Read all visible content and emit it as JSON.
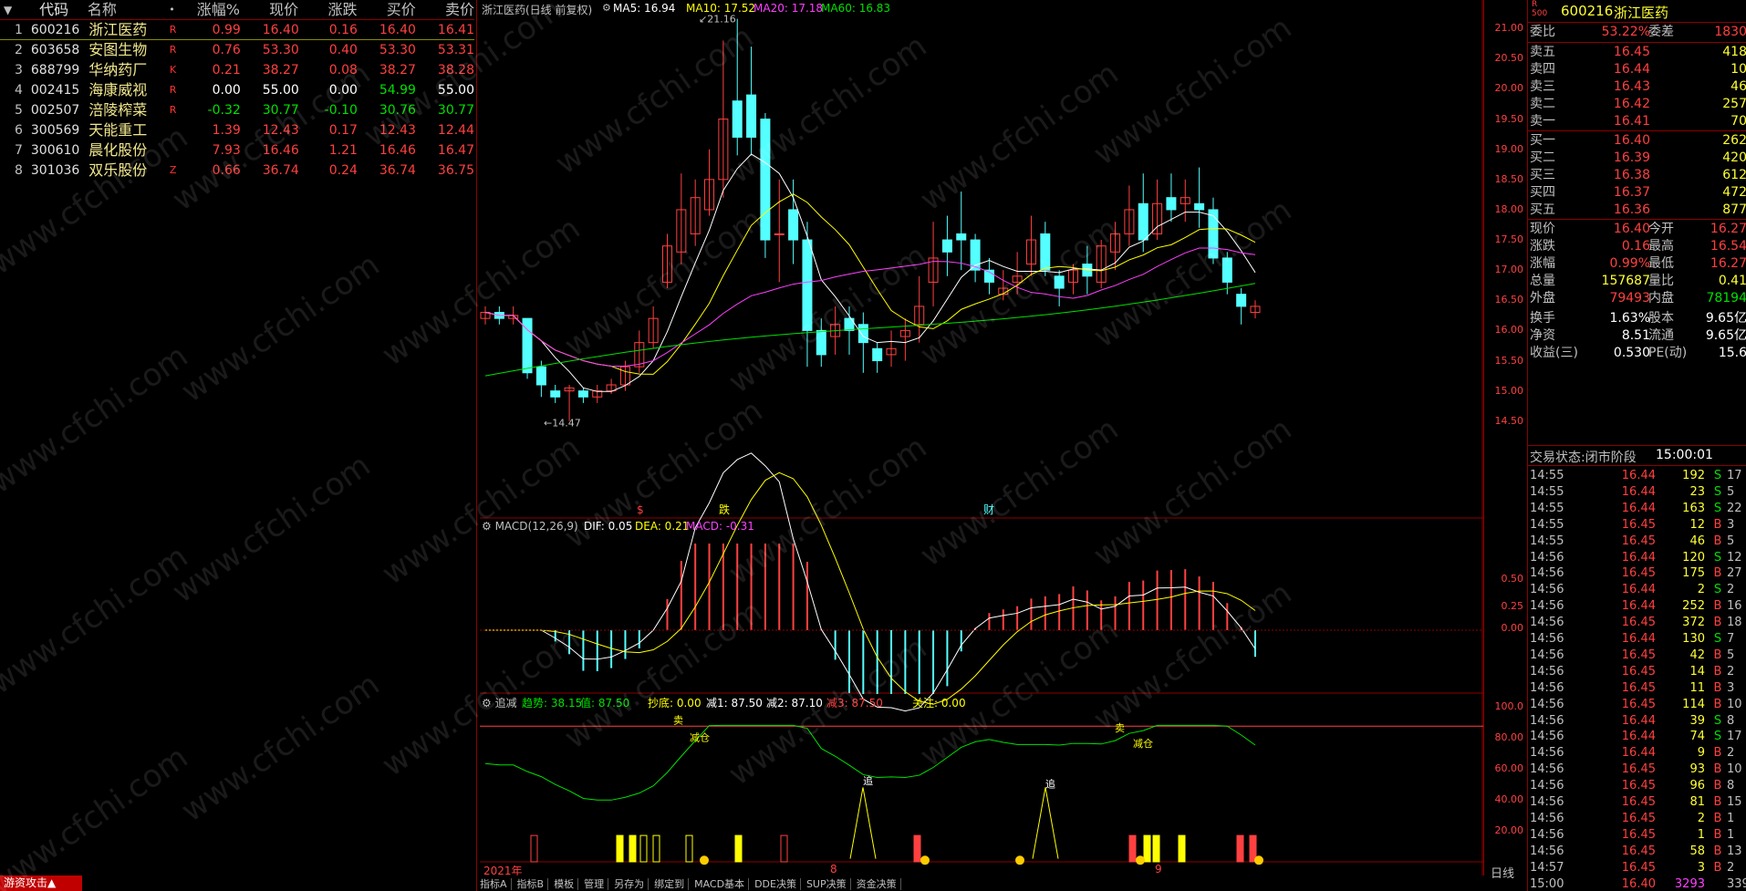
{
  "list": {
    "headers": [
      "代码",
      "名称",
      "•",
      "涨幅%",
      "现价",
      "涨跌",
      "买价",
      "卖价"
    ],
    "rows": [
      {
        "no": "1",
        "code": "600216",
        "name": "浙江医药",
        "flag": "R",
        "pct": "0.99",
        "price": "16.40",
        "chg": "0.16",
        "bid": "16.40",
        "ask": "16.41",
        "color": "red"
      },
      {
        "no": "2",
        "code": "603658",
        "name": "安图生物",
        "flag": "R",
        "pct": "0.76",
        "price": "53.30",
        "chg": "0.40",
        "bid": "53.30",
        "ask": "53.31",
        "color": "red"
      },
      {
        "no": "3",
        "code": "688799",
        "name": "华纳药厂",
        "flag": "K",
        "pct": "0.21",
        "price": "38.27",
        "chg": "0.08",
        "bid": "38.27",
        "ask": "38.28",
        "color": "red"
      },
      {
        "no": "4",
        "code": "002415",
        "name": "海康威视",
        "flag": "R",
        "pct": "0.00",
        "price": "55.00",
        "chg": "0.00",
        "bid": "54.99",
        "ask": "55.00",
        "color": "white"
      },
      {
        "no": "5",
        "code": "002507",
        "name": "涪陵榨菜",
        "flag": "R",
        "pct": "-0.32",
        "price": "30.77",
        "chg": "-0.10",
        "bid": "30.76",
        "ask": "30.77",
        "color": "green"
      },
      {
        "no": "6",
        "code": "300569",
        "name": "天能重工",
        "flag": "",
        "pct": "1.39",
        "price": "12.43",
        "chg": "0.17",
        "bid": "12.43",
        "ask": "12.44",
        "color": "red"
      },
      {
        "no": "7",
        "code": "300610",
        "name": "晨化股份",
        "flag": "",
        "pct": "7.93",
        "price": "16.46",
        "chg": "1.21",
        "bid": "16.46",
        "ask": "16.47",
        "color": "red"
      },
      {
        "no": "8",
        "code": "301036",
        "name": "双乐股份",
        "flag": "Z",
        "pct": "0.66",
        "price": "36.74",
        "chg": "0.24",
        "bid": "36.74",
        "ask": "36.75",
        "color": "red"
      }
    ],
    "bottom_tab": "游资攻击▲"
  },
  "chart": {
    "title": "浙江医药(日线 前复权)",
    "ma": {
      "ma5": "MA5: 16.94",
      "ma10": "MA10: 17.52",
      "ma20": "MA20: 17.18",
      "ma60": "MA60: 16.83"
    },
    "high_label": "21.16",
    "low_label": "14.47",
    "price_ticks": [
      "21.00",
      "20.50",
      "20.00",
      "19.50",
      "19.00",
      "18.50",
      "18.00",
      "17.50",
      "17.00",
      "16.50",
      "16.00",
      "15.50",
      "15.00",
      "14.50"
    ],
    "markers": {
      "s": "$",
      "die": "跌",
      "cai": "财"
    },
    "macd_title": "MACD(12,26,9)",
    "macd_dif": "DIF: 0.05",
    "macd_dea": "DEA: 0.21",
    "macd_macd": "MACD: -0.31",
    "macd_ticks": [
      "0.50",
      "0.25",
      "0.00"
    ],
    "ind_title": "追减",
    "ind_trend": "趋势: 38.15",
    "ind_val": "值: 87.50",
    "ind_bottom": "抄底: 0.00",
    "ind_j1": "减1: 87.50",
    "ind_j2": "减2: 87.10",
    "ind_j3": "减3: 87.50",
    "ind_focus": "关注: 0.00",
    "ind_ticks": [
      "100.0",
      "80.00",
      "60.00",
      "40.00",
      "20.00"
    ],
    "ind_labels": {
      "mai": "卖",
      "jiancang": "减仓",
      "zhui": "追"
    },
    "date_labels": [
      "2021年",
      "8",
      "9"
    ],
    "period": "日线"
  },
  "toolbar": [
    "指标A",
    "指标B",
    "模板",
    "管理",
    "另存为",
    "绑定到",
    "MACD基本",
    "DDE决策",
    "SUP决策",
    "资金决策"
  ],
  "right": {
    "header_code": "600216",
    "header_name": "浙江医药",
    "ratio": {
      "label": "委比",
      "value": "53.22%",
      "label2": "委差",
      "value2": "1830"
    },
    "asks": [
      {
        "label": "卖五",
        "price": "16.45",
        "vol": "418"
      },
      {
        "label": "卖四",
        "price": "16.44",
        "vol": "10"
      },
      {
        "label": "卖三",
        "price": "16.43",
        "vol": "46"
      },
      {
        "label": "卖二",
        "price": "16.42",
        "vol": "257"
      },
      {
        "label": "卖一",
        "price": "16.41",
        "vol": "70"
      }
    ],
    "bids": [
      {
        "label": "买一",
        "price": "16.40",
        "vol": "262"
      },
      {
        "label": "买二",
        "price": "16.39",
        "vol": "420"
      },
      {
        "label": "买三",
        "price": "16.38",
        "vol": "612"
      },
      {
        "label": "买四",
        "price": "16.37",
        "vol": "472"
      },
      {
        "label": "买五",
        "price": "16.36",
        "vol": "877"
      }
    ],
    "stats": [
      {
        "l": "现价",
        "v": "16.40",
        "c": "red",
        "l2": "今开",
        "v2": "16.27",
        "c2": "red"
      },
      {
        "l": "涨跌",
        "v": "0.16",
        "c": "red",
        "l2": "最高",
        "v2": "16.54",
        "c2": "red"
      },
      {
        "l": "涨幅",
        "v": "0.99%",
        "c": "red",
        "l2": "最低",
        "v2": "16.27",
        "c2": "red"
      },
      {
        "l": "总量",
        "v": "157687",
        "c": "yellow",
        "l2": "量比",
        "v2": "0.41",
        "c2": "yellow"
      },
      {
        "l": "外盘",
        "v": "79493",
        "c": "red",
        "l2": "内盘",
        "v2": "78194",
        "c2": "green"
      },
      {
        "l": "换手",
        "v": "1.63%",
        "c": "white",
        "l2": "股本",
        "v2": "9.65亿",
        "c2": "white"
      },
      {
        "l": "净资",
        "v": "8.51",
        "c": "white",
        "l2": "流通",
        "v2": "9.65亿",
        "c2": "white"
      },
      {
        "l": "收益(三)",
        "v": "0.530",
        "c": "white",
        "l2": "PE(动)",
        "v2": "15.6",
        "c2": "white"
      }
    ],
    "trade_status": "交易状态:闭市阶段",
    "trade_time": "15:00:01",
    "ticks": [
      {
        "t": "14:55",
        "p": "16.44",
        "q": "192",
        "s": "S",
        "n": "17",
        "pc": "red",
        "sc": "green"
      },
      {
        "t": "14:55",
        "p": "16.44",
        "q": "23",
        "s": "S",
        "n": "5",
        "pc": "red",
        "sc": "green"
      },
      {
        "t": "14:55",
        "p": "16.44",
        "q": "163",
        "s": "S",
        "n": "22",
        "pc": "red",
        "sc": "green"
      },
      {
        "t": "14:55",
        "p": "16.45",
        "q": "12",
        "s": "B",
        "n": "3",
        "pc": "red",
        "sc": "red"
      },
      {
        "t": "14:55",
        "p": "16.45",
        "q": "46",
        "s": "B",
        "n": "5",
        "pc": "red",
        "sc": "red"
      },
      {
        "t": "14:56",
        "p": "16.44",
        "q": "120",
        "s": "S",
        "n": "12",
        "pc": "red",
        "sc": "green"
      },
      {
        "t": "14:56",
        "p": "16.45",
        "q": "175",
        "s": "B",
        "n": "27",
        "pc": "red",
        "sc": "red"
      },
      {
        "t": "14:56",
        "p": "16.44",
        "q": "2",
        "s": "S",
        "n": "2",
        "pc": "red",
        "sc": "green"
      },
      {
        "t": "14:56",
        "p": "16.44",
        "q": "252",
        "s": "B",
        "n": "16",
        "pc": "red",
        "sc": "red"
      },
      {
        "t": "14:56",
        "p": "16.45",
        "q": "372",
        "s": "B",
        "n": "18",
        "pc": "red",
        "sc": "red"
      },
      {
        "t": "14:56",
        "p": "16.44",
        "q": "130",
        "s": "S",
        "n": "7",
        "pc": "red",
        "sc": "green"
      },
      {
        "t": "14:56",
        "p": "16.45",
        "q": "42",
        "s": "B",
        "n": "5",
        "pc": "red",
        "sc": "red"
      },
      {
        "t": "14:56",
        "p": "16.45",
        "q": "14",
        "s": "B",
        "n": "2",
        "pc": "red",
        "sc": "red"
      },
      {
        "t": "14:56",
        "p": "16.45",
        "q": "11",
        "s": "B",
        "n": "3",
        "pc": "red",
        "sc": "red"
      },
      {
        "t": "14:56",
        "p": "16.45",
        "q": "114",
        "s": "B",
        "n": "10",
        "pc": "red",
        "sc": "red"
      },
      {
        "t": "14:56",
        "p": "16.44",
        "q": "39",
        "s": "S",
        "n": "8",
        "pc": "red",
        "sc": "green"
      },
      {
        "t": "14:56",
        "p": "16.44",
        "q": "74",
        "s": "S",
        "n": "17",
        "pc": "red",
        "sc": "green"
      },
      {
        "t": "14:56",
        "p": "16.44",
        "q": "9",
        "s": "B",
        "n": "2",
        "pc": "red",
        "sc": "red"
      },
      {
        "t": "14:56",
        "p": "16.45",
        "q": "93",
        "s": "B",
        "n": "10",
        "pc": "red",
        "sc": "red"
      },
      {
        "t": "14:56",
        "p": "16.45",
        "q": "96",
        "s": "B",
        "n": "8",
        "pc": "red",
        "sc": "red"
      },
      {
        "t": "14:56",
        "p": "16.45",
        "q": "81",
        "s": "B",
        "n": "15",
        "pc": "red",
        "sc": "red"
      },
      {
        "t": "14:56",
        "p": "16.45",
        "q": "2",
        "s": "B",
        "n": "1",
        "pc": "red",
        "sc": "red"
      },
      {
        "t": "14:56",
        "p": "16.45",
        "q": "1",
        "s": "B",
        "n": "1",
        "pc": "red",
        "sc": "red"
      },
      {
        "t": "14:56",
        "p": "16.45",
        "q": "58",
        "s": "B",
        "n": "13",
        "pc": "red",
        "sc": "red"
      },
      {
        "t": "14:57",
        "p": "16.45",
        "q": "3",
        "s": "B",
        "n": "2",
        "pc": "red",
        "sc": "red"
      },
      {
        "t": "15:00",
        "p": "16.40",
        "q": "3293",
        "s": "",
        "n": "339",
        "pc": "red",
        "sc": "red",
        "qc": "mag"
      }
    ]
  },
  "watermark": "www.cfchi.com",
  "colors": {
    "up": "#ff4040",
    "down": "#54ffff",
    "ma5": "#ffffff",
    "ma10": "#ffff00",
    "ma20": "#ff40ff",
    "ma60": "#00e000",
    "grid": "#8b0000"
  }
}
